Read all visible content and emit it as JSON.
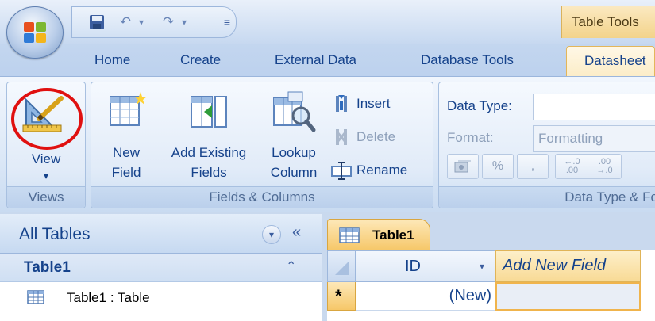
{
  "title_bar": {
    "context_tab": "Table Tools"
  },
  "tabs": [
    "Home",
    "Create",
    "External Data",
    "Database Tools",
    "Datasheet"
  ],
  "ribbon": {
    "views_group": {
      "label": "Views",
      "view_button": "View"
    },
    "fields_group": {
      "label": "Fields & Columns",
      "new_field": [
        "New",
        "Field"
      ],
      "add_existing": [
        "Add Existing",
        "Fields"
      ],
      "lookup": [
        "Lookup",
        "Column"
      ],
      "insert": "Insert",
      "delete": "Delete",
      "rename": "Rename"
    },
    "datatype_group": {
      "label": "Data Type & Fo",
      "data_type_label": "Data Type:",
      "data_type_value": "",
      "format_label": "Format:",
      "format_value": "Formatting",
      "percent": "%",
      "comma": ",",
      "inc_decimal": "←.0\n.00",
      "dec_decimal": ".00\n→.0"
    }
  },
  "nav_pane": {
    "title": "All Tables",
    "group": "Table1",
    "item": "Table1 : Table"
  },
  "document": {
    "tab": "Table1",
    "columns": [
      "ID",
      "Add New Field"
    ],
    "new_row_marker": "*",
    "new_row_id": "(New)"
  },
  "colors": {
    "accent": "#15428b",
    "highlight_circle": "#e01010",
    "context_tab": "#f3d38a"
  }
}
